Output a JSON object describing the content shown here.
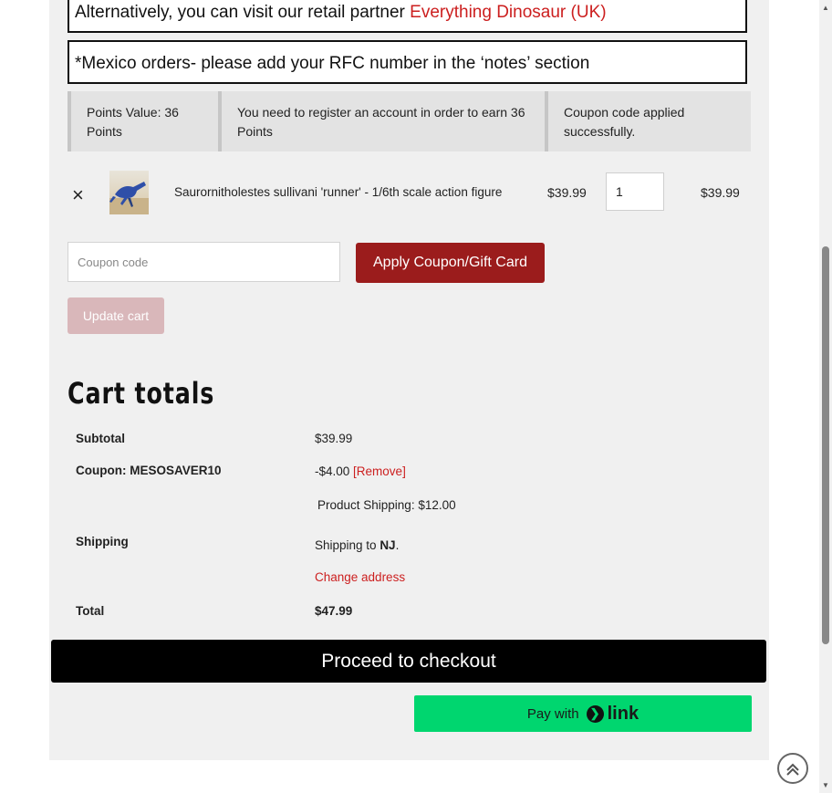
{
  "notices": {
    "retail_text": "Alternatively, you can visit our retail partner ",
    "retail_link": "Everything Dinosaur (UK)",
    "mexico": "*Mexico orders- please add your RFC number in the ‘notes’ section"
  },
  "info": {
    "points_value": "Points Value: 36 Points",
    "register": "You need to register an account in order to earn 36 Points",
    "coupon_applied": "Coupon code applied successfully."
  },
  "cart_item": {
    "remove": "×",
    "name": "Saurornitholestes sullivani 'runner' - 1/6th scale action figure",
    "price": "$39.99",
    "quantity": "1",
    "subtotal": "$39.99"
  },
  "coupon": {
    "placeholder": "Coupon code",
    "apply_label": "Apply Coupon/Gift Card",
    "update_label": "Update cart"
  },
  "totals": {
    "title": "Cart totals",
    "subtotal_label": "Subtotal",
    "subtotal_value": "$39.99",
    "coupon_label": "Coupon: MESOSAVER10",
    "coupon_value": "-$4.00",
    "coupon_remove": "[Remove]",
    "product_shipping": "Product Shipping: $12.00",
    "shipping_label": "Shipping",
    "shipping_to": "Shipping to ",
    "shipping_state": "NJ",
    "shipping_period": ".",
    "change_address": "Change address",
    "total_label": "Total",
    "total_value": "$47.99"
  },
  "actions": {
    "checkout_label": "Proceed to checkout",
    "pay_with": "Pay with",
    "link_word": "link"
  },
  "colors": {
    "accent_red": "#9b1c1c",
    "link_red": "#cc1f1f",
    "link_green": "#00d66f"
  }
}
